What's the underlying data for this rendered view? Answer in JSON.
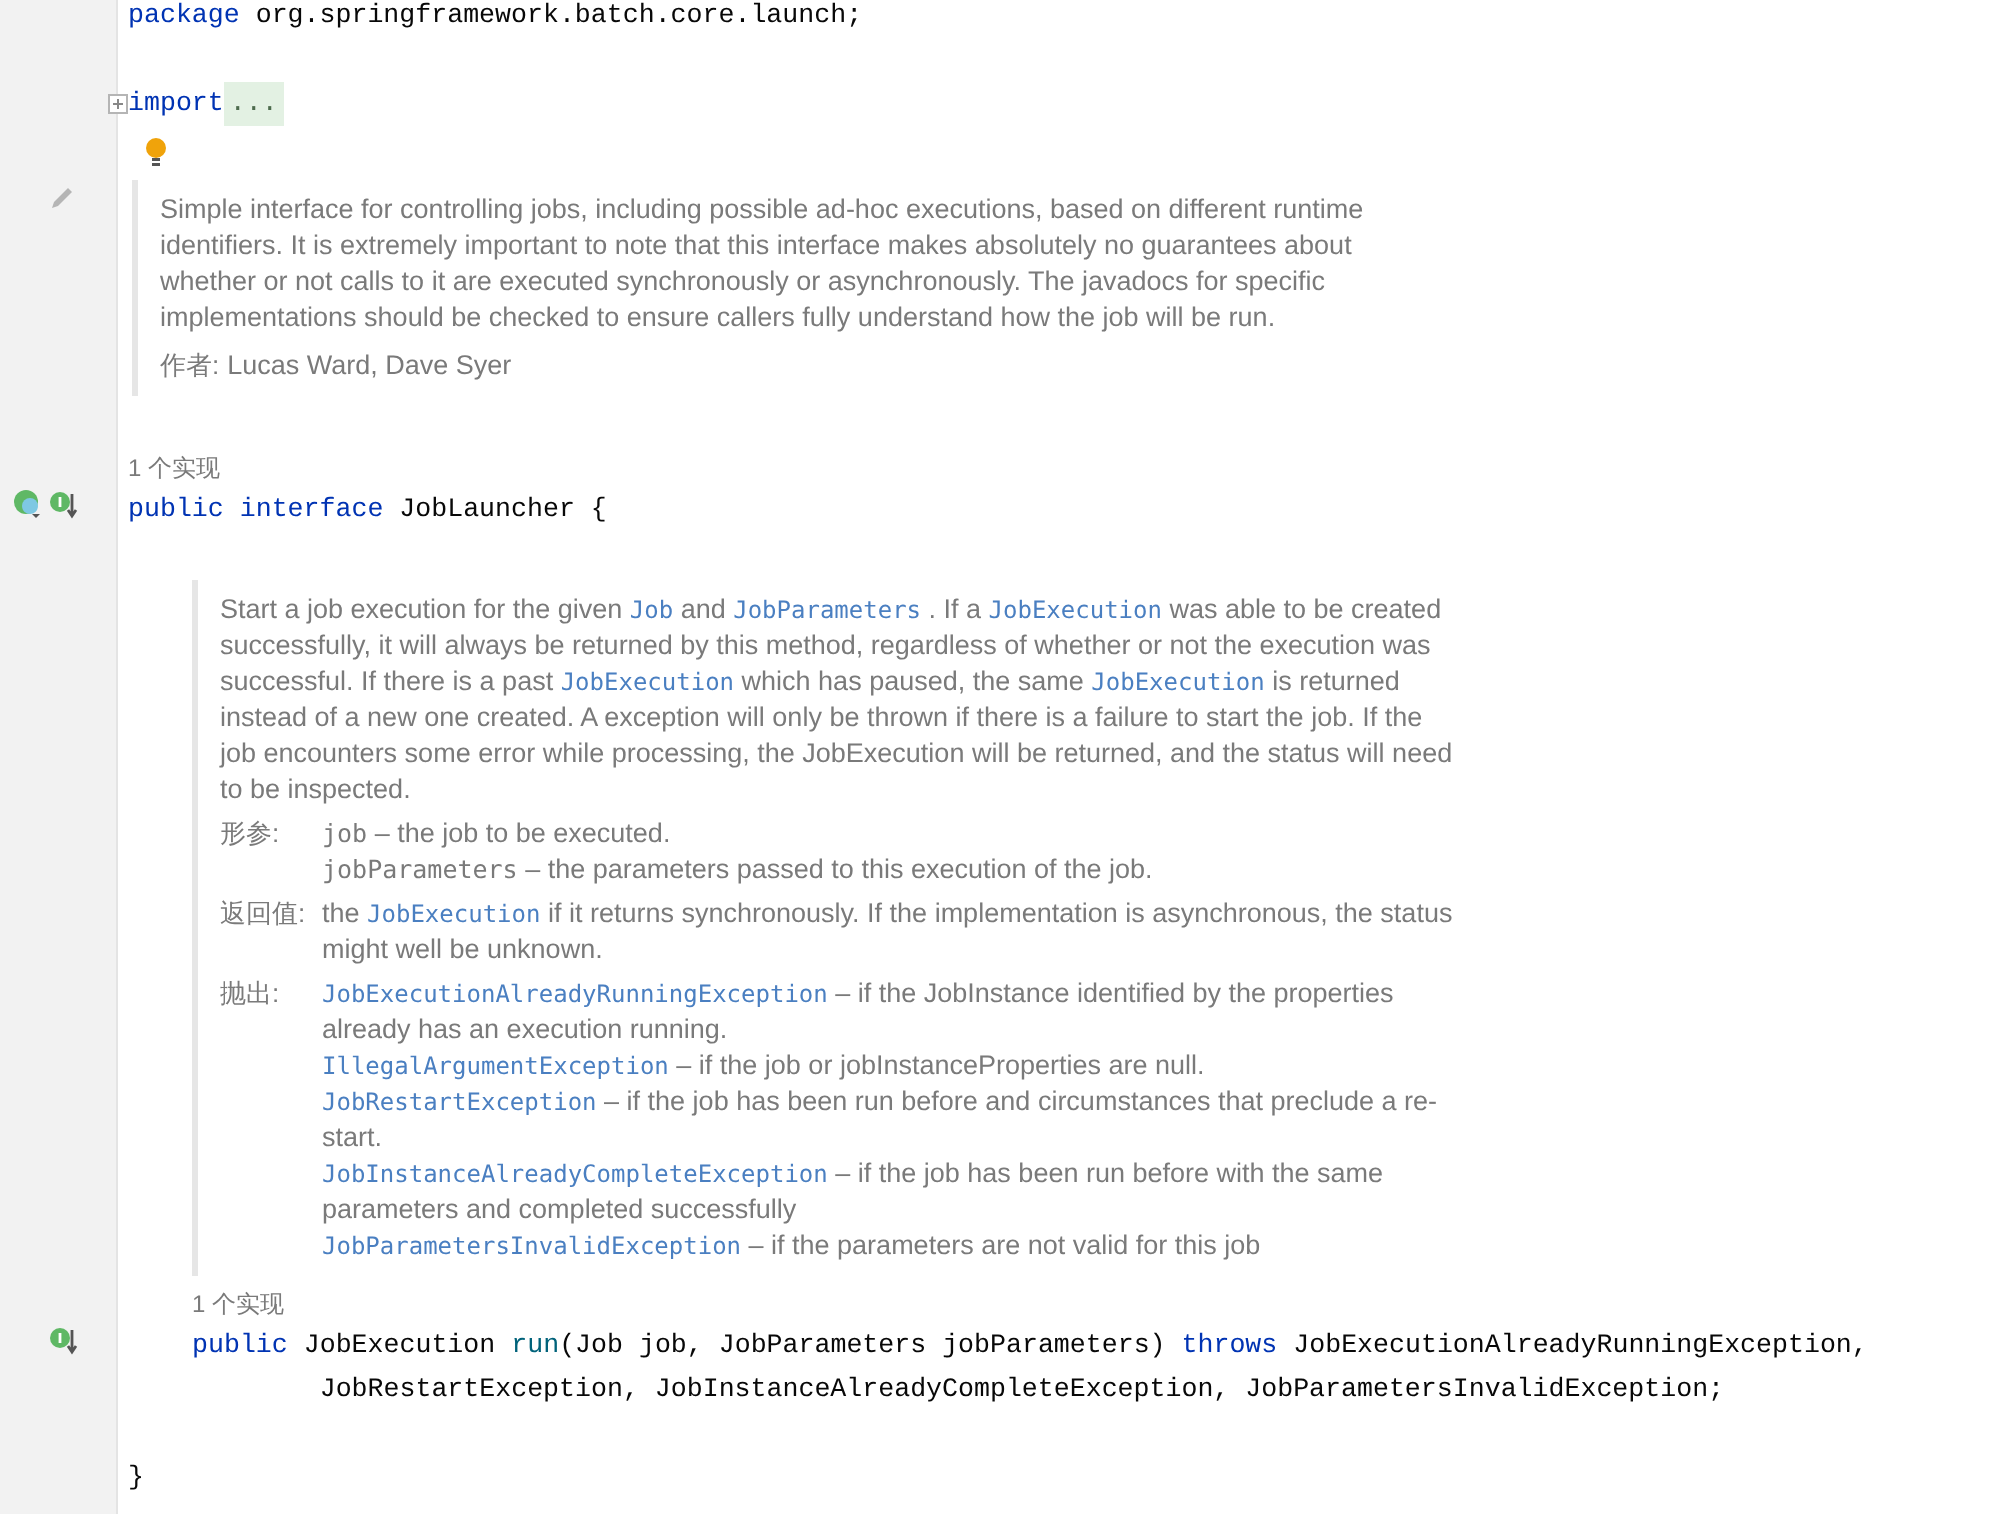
{
  "editor": {
    "rows": [
      {
        "kind": "code",
        "tokens": [
          {
            "kind": "keyword",
            "text": "package"
          },
          {
            "kind": "plain",
            "text": " org.springframework.batch.core.launch;"
          }
        ]
      },
      {
        "kind": "blank"
      },
      {
        "kind": "code",
        "foldable": true,
        "tokens": [
          {
            "kind": "keyword",
            "text": "import"
          },
          {
            "kind": "fold",
            "text": "..."
          }
        ]
      },
      {
        "kind": "bulb"
      },
      {
        "kind": "doc",
        "gutter_icons": [
          {
            "kind": "pencil"
          }
        ],
        "paragraph": [
          {
            "kind": "text",
            "text": "Simple interface for controlling jobs, including possible ad-hoc executions, based on different runtime identifiers. It is extremely important to note that this interface makes absolutely no guarantees about whether or not calls to it are executed synchronously or asynchronously. The javadocs for specific implementations should be checked to ensure callers fully understand how the job will be run."
          }
        ],
        "tags": [
          {
            "label": "作者:",
            "inline": true,
            "items": [
              [
                {
                  "kind": "text",
                  "text": "Lucas Ward, Dave Syer"
                }
              ]
            ]
          }
        ]
      },
      {
        "kind": "blank"
      },
      {
        "kind": "hint",
        "text": "1 个实现"
      },
      {
        "kind": "code",
        "gutter_icons": [
          {
            "kind": "implemented"
          },
          {
            "kind": "overridden"
          }
        ],
        "tokens": [
          {
            "kind": "keyword",
            "text": "public interface"
          },
          {
            "kind": "plain",
            "text": " JobLauncher {"
          }
        ],
        "children": [
          {
            "kind": "blank"
          },
          {
            "kind": "doc",
            "paragraph": [
              {
                "kind": "text",
                "text": "Start a job execution for the given "
              },
              {
                "kind": "link",
                "text": "Job"
              },
              {
                "kind": "text",
                "text": " and "
              },
              {
                "kind": "link",
                "text": "JobParameters"
              },
              {
                "kind": "text",
                "text": " . If a "
              },
              {
                "kind": "link",
                "text": "JobExecution"
              },
              {
                "kind": "text",
                "text": " was able to be created successfully, it will always be returned by this method, regardless of whether or not the execution was successful. If there is a past "
              },
              {
                "kind": "link",
                "text": "JobExecution"
              },
              {
                "kind": "text",
                "text": " which has paused, the same "
              },
              {
                "kind": "link",
                "text": "JobExecution"
              },
              {
                "kind": "text",
                "text": " is returned instead of a new one created. A exception will only be thrown if there is a failure to start the job. If the job encounters some error while processing, the JobExecution will be returned, and the status will need to be inspected."
              }
            ],
            "tags": [
              {
                "label": "形参:",
                "items": [
                  [
                    {
                      "kind": "param",
                      "text": "job"
                    },
                    {
                      "kind": "text",
                      "text": " – the job to be executed."
                    }
                  ],
                  [
                    {
                      "kind": "param",
                      "text": "jobParameters"
                    },
                    {
                      "kind": "text",
                      "text": " – the parameters passed to this execution of the job."
                    }
                  ]
                ]
              },
              {
                "label": "返回值:",
                "items": [
                  [
                    {
                      "kind": "text",
                      "text": "the "
                    },
                    {
                      "kind": "link",
                      "text": "JobExecution"
                    },
                    {
                      "kind": "text",
                      "text": " if it returns synchronously. If the implementation is asynchronous, the status might well be unknown."
                    }
                  ]
                ]
              },
              {
                "label": "抛出:",
                "items": [
                  [
                    {
                      "kind": "link",
                      "text": "JobExecutionAlreadyRunningException"
                    },
                    {
                      "kind": "text",
                      "text": " – if the JobInstance identified by the properties already has an execution running."
                    }
                  ],
                  [
                    {
                      "kind": "link",
                      "text": "IllegalArgumentException"
                    },
                    {
                      "kind": "text",
                      "text": " – if the job or jobInstanceProperties are null."
                    }
                  ],
                  [
                    {
                      "kind": "link",
                      "text": "JobRestartException"
                    },
                    {
                      "kind": "text",
                      "text": " – if the job has been run before and circumstances that preclude a re-start."
                    }
                  ],
                  [
                    {
                      "kind": "link",
                      "text": "JobInstanceAlreadyCompleteException"
                    },
                    {
                      "kind": "text",
                      "text": " – if the job has been run before with the same parameters and completed successfully"
                    }
                  ],
                  [
                    {
                      "kind": "link",
                      "text": "JobParametersInvalidException"
                    },
                    {
                      "kind": "text",
                      "text": " – if the parameters are not valid for this job"
                    }
                  ]
                ]
              }
            ]
          },
          {
            "kind": "hint",
            "text": "1 个实现"
          },
          {
            "kind": "code",
            "gutter_icons": [
              {
                "kind": "overridden"
              }
            ],
            "tokens": [
              {
                "kind": "keyword",
                "text": "public"
              },
              {
                "kind": "plain",
                "text": " JobExecution "
              },
              {
                "kind": "method",
                "text": "run"
              },
              {
                "kind": "plain",
                "text": "(Job job, JobParameters jobParameters) "
              },
              {
                "kind": "keyword",
                "text": "throws"
              },
              {
                "kind": "plain",
                "text": " JobExecutionAlreadyRunningException,"
              }
            ]
          },
          {
            "kind": "code",
            "tokens": [
              {
                "kind": "plain",
                "text": "        JobRestartException, JobInstanceAlreadyCompleteException, JobParametersInvalidException;"
              }
            ]
          },
          {
            "kind": "blank"
          }
        ]
      },
      {
        "kind": "code",
        "tokens": [
          {
            "kind": "plain",
            "text": "}"
          }
        ]
      }
    ]
  }
}
